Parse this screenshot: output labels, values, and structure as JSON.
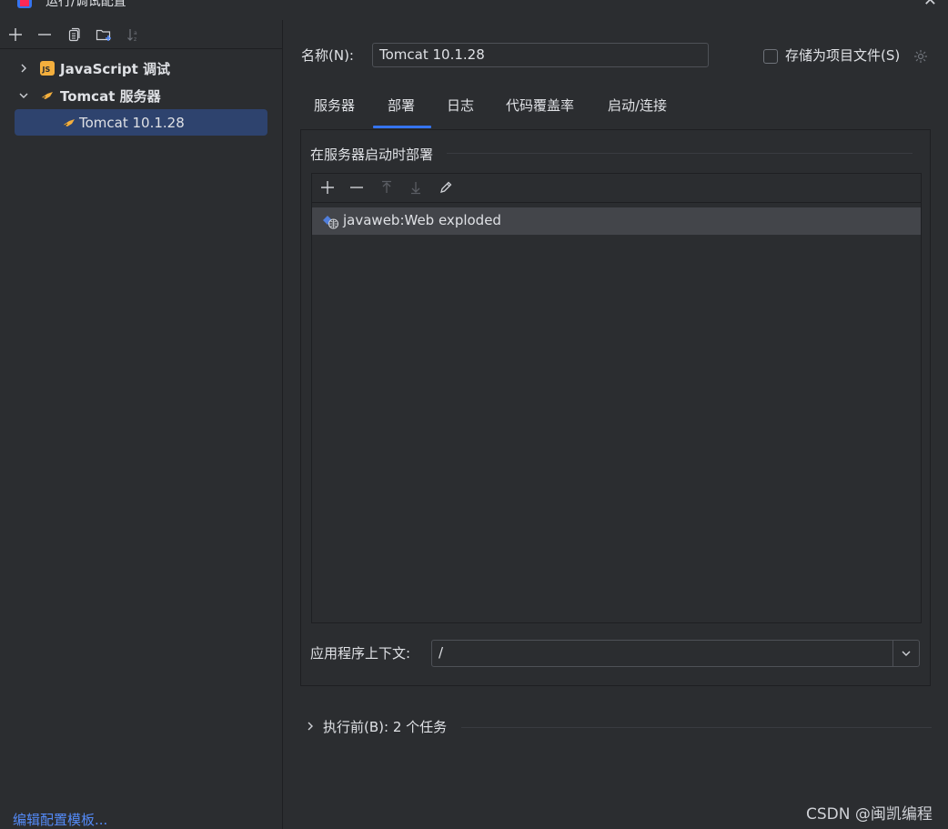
{
  "window": {
    "title": "运行/调试配置"
  },
  "left_toolbar": {
    "icons": [
      "add-icon",
      "remove-icon",
      "copy-icon",
      "new-folder-icon",
      "sort-icon"
    ]
  },
  "tree": {
    "items": [
      {
        "label": "JavaScript 调试",
        "icon": "javascript-debug-icon",
        "expanded": false
      },
      {
        "label": "Tomcat 服务器",
        "icon": "tomcat-icon",
        "expanded": true
      },
      {
        "label": "Tomcat 10.1.28",
        "icon": "tomcat-icon",
        "selected": true
      }
    ]
  },
  "footer_link": "编辑配置模板...",
  "name_field": {
    "label": "名称(N):",
    "value": "Tomcat 10.1.28"
  },
  "store_option": {
    "label": "存储为项目文件(S)",
    "checked": false
  },
  "tabs": [
    {
      "label": "服务器",
      "active": false
    },
    {
      "label": "部署",
      "active": true
    },
    {
      "label": "日志",
      "active": false
    },
    {
      "label": "代码覆盖率",
      "active": false
    },
    {
      "label": "启动/连接",
      "active": false
    }
  ],
  "deploy": {
    "section_title": "在服务器启动时部署",
    "toolbar_icons": [
      "add-icon",
      "remove-icon",
      "move-up-icon",
      "move-down-icon",
      "edit-icon"
    ],
    "artifacts": [
      {
        "label": "javaweb:Web exploded",
        "icon": "web-artifact-icon"
      }
    ],
    "context_label": "应用程序上下文:",
    "context_value": "/"
  },
  "before_launch": {
    "label": "执行前(B): 2 个任务",
    "expanded": false
  },
  "watermark": "CSDN @闽凯编程",
  "colors": {
    "accent": "#3574f0",
    "selection": "#2e436e",
    "link": "#548af7",
    "background": "#2b2d30"
  }
}
